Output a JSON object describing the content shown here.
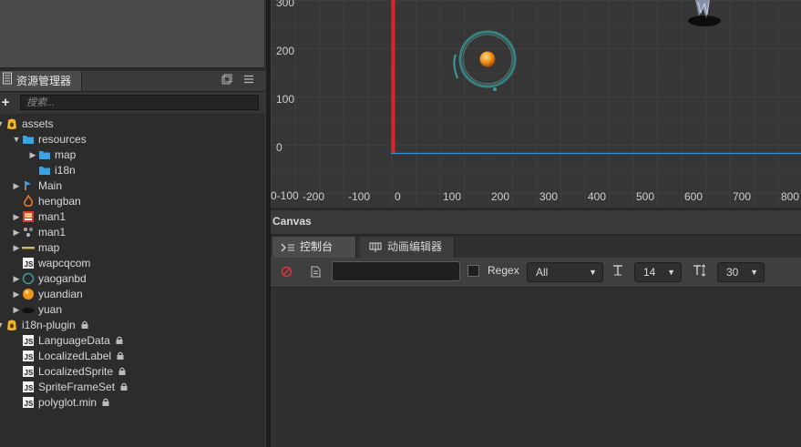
{
  "assets_panel": {
    "tab_label": "资源管理器",
    "search_placeholder": "搜索...",
    "tree": [
      {
        "label": "assets",
        "indent": 0,
        "arrow": "down",
        "icon": "db-icon",
        "locked": false
      },
      {
        "label": "resources",
        "indent": 1,
        "arrow": "down",
        "icon": "folder-icon",
        "locked": false
      },
      {
        "label": "map",
        "indent": 2,
        "arrow": "right",
        "icon": "folder-icon",
        "locked": false
      },
      {
        "label": "i18n",
        "indent": 2,
        "arrow": "",
        "icon": "folder-icon",
        "locked": false
      },
      {
        "label": "Main",
        "indent": 1,
        "arrow": "right",
        "icon": "scene-icon",
        "locked": false
      },
      {
        "label": "hengban",
        "indent": 1,
        "arrow": "",
        "icon": "fire-icon",
        "locked": false
      },
      {
        "label": "man1",
        "indent": 1,
        "arrow": "right",
        "icon": "image-icon",
        "locked": false
      },
      {
        "label": "man1",
        "indent": 1,
        "arrow": "right",
        "icon": "animation-icon",
        "locked": false
      },
      {
        "label": "map",
        "indent": 1,
        "arrow": "right",
        "icon": "tilemap-icon",
        "locked": false
      },
      {
        "label": "wapcqcom",
        "indent": 1,
        "arrow": "",
        "icon": "js-file-icon",
        "locked": false
      },
      {
        "label": "yaoganbd",
        "indent": 1,
        "arrow": "right",
        "icon": "joystick-icon",
        "locked": false
      },
      {
        "label": "yuandian",
        "indent": 1,
        "arrow": "right",
        "icon": "orb-icon",
        "locked": false
      },
      {
        "label": "yuan",
        "indent": 1,
        "arrow": "right",
        "icon": "shadow-icon",
        "locked": false
      },
      {
        "label": "i18n-plugin",
        "indent": 0,
        "arrow": "down",
        "icon": "db-icon",
        "locked": true
      },
      {
        "label": "LanguageData",
        "indent": 1,
        "arrow": "",
        "icon": "js-file-icon",
        "locked": true
      },
      {
        "label": "LocalizedLabel",
        "indent": 1,
        "arrow": "",
        "icon": "js-file-icon",
        "locked": true
      },
      {
        "label": "LocalizedSprite",
        "indent": 1,
        "arrow": "",
        "icon": "js-file-icon",
        "locked": true
      },
      {
        "label": "SpriteFrameSet",
        "indent": 1,
        "arrow": "",
        "icon": "js-file-icon",
        "locked": true
      },
      {
        "label": "polyglot.min",
        "indent": 1,
        "arrow": "",
        "icon": "js-file-icon",
        "locked": true
      }
    ]
  },
  "scene": {
    "y_ticks": [
      "300",
      "200",
      "100",
      "0"
    ],
    "x_ticks": [
      "0-100",
      "-200",
      "-100",
      "0",
      "100",
      "200",
      "300",
      "400",
      "500",
      "600",
      "700",
      "800"
    ],
    "colors": {
      "y_axis": "#e0242a",
      "x_axis": "#2f8fd8",
      "orb": "#f2931c",
      "ring": "#3f8f8f"
    }
  },
  "canvas_label": "Canvas",
  "bottom_tabs": {
    "console": "控制台",
    "animation_editor": "动画编辑器"
  },
  "console_toolbar": {
    "filter_value": "",
    "regex_label": "Regex",
    "log_level": "All",
    "font_size": "14",
    "line_height": "30"
  }
}
